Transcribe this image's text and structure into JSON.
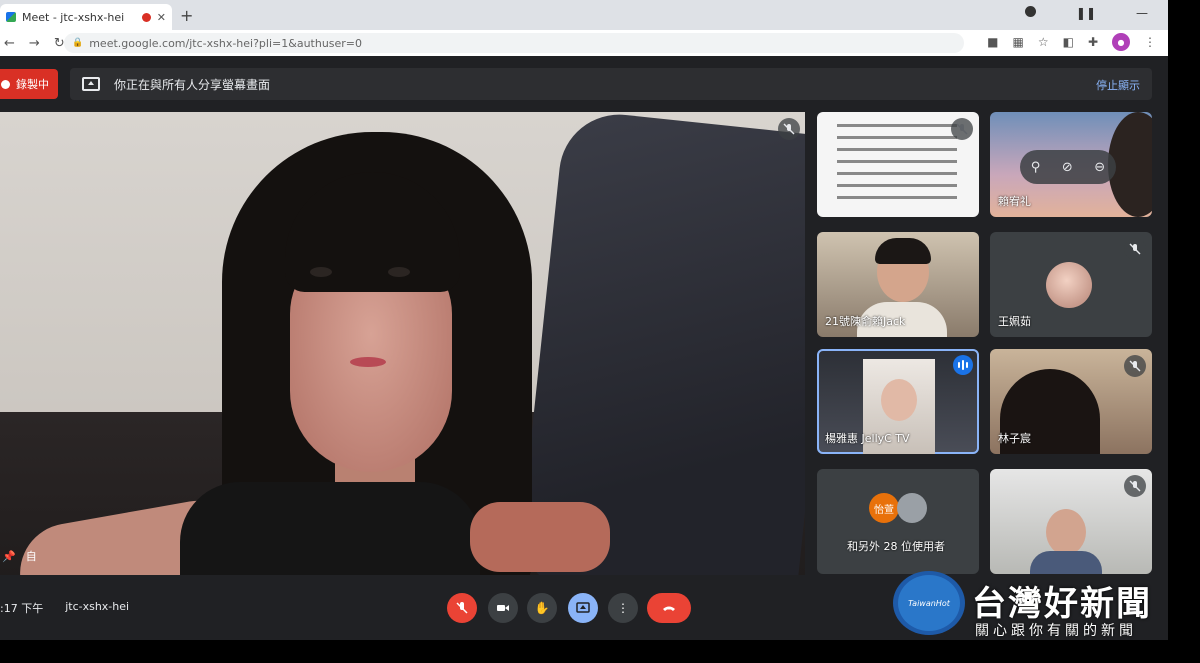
{
  "browser": {
    "tab_title": "Meet - jtc-xshx-hei",
    "new_tab": "+",
    "url": "meet.google.com/jtc-xshx-hei?pli=1&authuser=0"
  },
  "meet": {
    "recording_label": "錄製中",
    "banner_text": "你正在與所有人分享螢幕畫面",
    "banner_stop": "停止顯示",
    "main_pin_label": "自",
    "tiles": [
      {
        "name": ""
      },
      {
        "name": "賴宥礼"
      },
      {
        "name": "21號陳俞賴Jack"
      },
      {
        "name": "王姵茹"
      },
      {
        "name": "楊雅惠 JellyC TV"
      },
      {
        "name": "林子宸"
      },
      {
        "name": "和另外 28 位使用者",
        "avatar_label": "怡萱"
      },
      {
        "name": ""
      }
    ],
    "hover_controls": [
      "pin",
      "mute",
      "remove"
    ],
    "meeting_time": ":17 下午",
    "meeting_code": "jtc-xshx-hei"
  },
  "colors": {
    "meet_bg": "#202124",
    "record_red": "#d93025",
    "hangup_red": "#ea4335",
    "present_blue": "#8ab4f8",
    "speaking_blue": "#1a73e8"
  },
  "watermark": {
    "logo_text": "TaiwanHot",
    "title": "台灣好新聞",
    "subtitle": "關心跟你有關的新聞"
  }
}
